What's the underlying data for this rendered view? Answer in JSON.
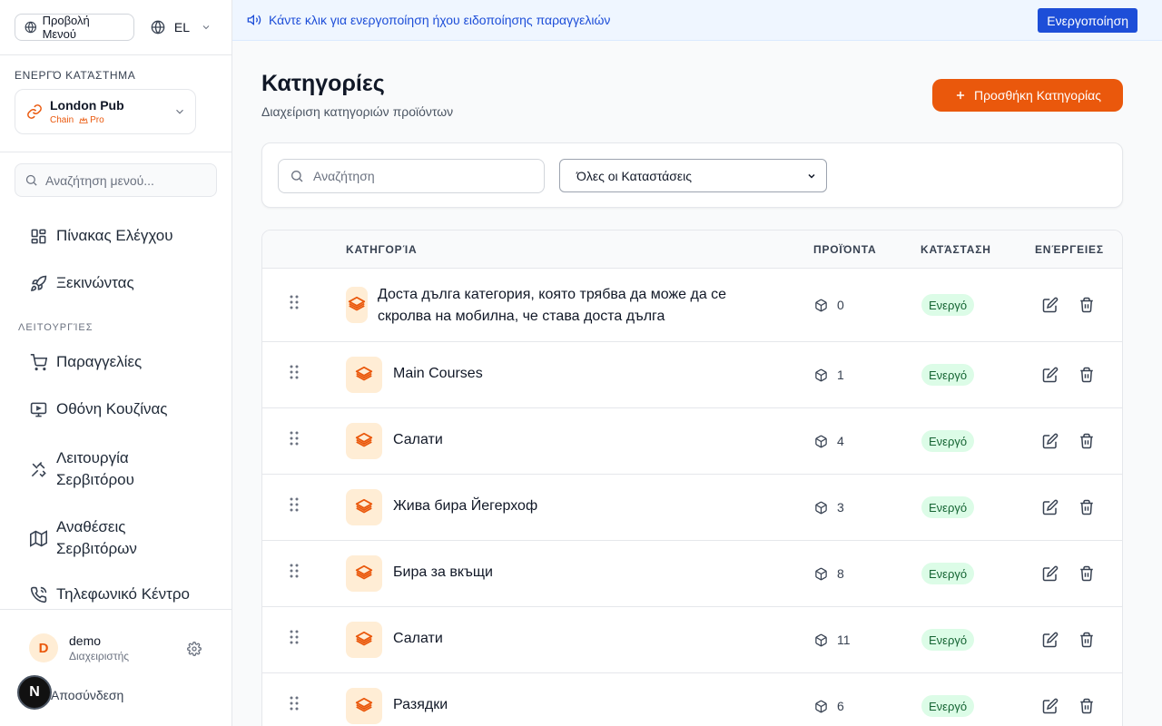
{
  "sidebar": {
    "menu_view_label": "Προβολή Μενού",
    "language": "EL",
    "active_store_label": "ΕΝΕΡΓΌ ΚΑΤΆΣΤΗΜΑ",
    "store_name": "London Pub",
    "store_type": "Chain",
    "store_plan": "Pro",
    "search_placeholder": "Αναζήτηση μενού...",
    "nav_top": [
      {
        "label": "Πίνακας Ελέγχου",
        "icon": "dashboard-icon"
      },
      {
        "label": "Ξεκινώντας",
        "icon": "rocket-icon"
      }
    ],
    "section_label": "ΛΕΙΤΟΥΡΓΊΕΣ",
    "nav_ops": [
      {
        "label": "Παραγγελίες",
        "icon": "cart-icon"
      },
      {
        "label": "Οθόνη Κουζίνας",
        "icon": "monitor-icon"
      },
      {
        "label": "Λειτουργία Σερβιτόρου",
        "icon": "utensils-icon"
      },
      {
        "label": "Αναθέσεις Σερβιτόρων",
        "icon": "map-icon"
      },
      {
        "label": "Τηλεφωνικό Κέντρο",
        "icon": "phone-icon"
      }
    ],
    "user": {
      "initial": "D",
      "name": "demo",
      "role": "Διαχειριστής"
    },
    "logout_label": "Αποσύνδεση",
    "badge_letter": "N"
  },
  "banner": {
    "text": "Κάντε κλικ για ενεργοποίηση ήχου ειδοποίησης παραγγελιών",
    "button_label": "Ενεργοποίηση"
  },
  "page": {
    "title": "Κατηγορίες",
    "subtitle": "Διαχείριση κατηγοριών προϊόντων",
    "add_button_label": "Προσθήκη Κατηγορίας"
  },
  "filters": {
    "search_placeholder": "Αναζήτηση",
    "status_selected": "Όλες οι Καταστάσεις"
  },
  "table": {
    "headers": {
      "category": "ΚΑΤΗΓΟΡΊΑ",
      "products": "ΠΡΟΪΌΝΤΑ",
      "status": "ΚΑΤΆΣΤΑΣΗ",
      "actions": "ΕΝΈΡΓΕΙΕΣ"
    },
    "rows": [
      {
        "name_line1": "Доста дълга категория, която трябва да може да се",
        "name_line2": "скролва на мобилна, че става доста дълга",
        "products": "0",
        "status": "Ενεργό"
      },
      {
        "name": "Main Courses",
        "products": "1",
        "status": "Ενεργό"
      },
      {
        "name": "Салати",
        "products": "4",
        "status": "Ενεργό"
      },
      {
        "name": "Жива бира Йегерхоф",
        "products": "3",
        "status": "Ενεργό"
      },
      {
        "name": "Бира за вкъщи",
        "products": "8",
        "status": "Ενεργό"
      },
      {
        "name": "Салати",
        "products": "11",
        "status": "Ενεργό"
      },
      {
        "name": "Разядки",
        "products": "6",
        "status": "Ενεργό"
      }
    ]
  }
}
